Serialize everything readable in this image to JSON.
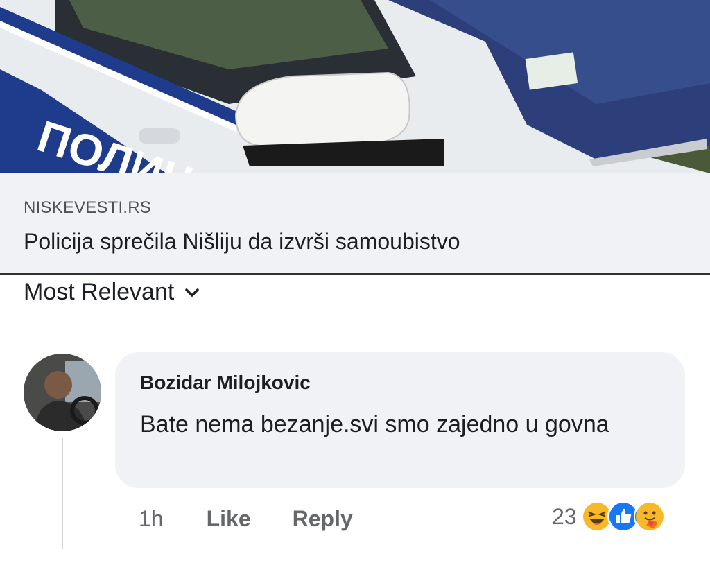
{
  "link_preview": {
    "image_alt": "police car",
    "domain": "NISKEVESTI.RS",
    "title": "Policija sprečila Nišliju da izvrši samoubistvo"
  },
  "sort": {
    "label": "Most Relevant",
    "icon": "chevron-down-icon"
  },
  "comment": {
    "author": "Bozidar Milojkovic",
    "text": "Bate nema bezanje.svi smo zajedno u govna",
    "time": "1h",
    "like_label": "Like",
    "reply_label": "Reply",
    "reaction_count": "23",
    "reactions": [
      "haha-reaction-icon",
      "like-reaction-icon",
      "care-reaction-icon"
    ]
  },
  "colors": {
    "caption_bg": "#f0f2f5",
    "text_primary": "#1c1e21",
    "text_secondary": "#65676b",
    "like_blue": "#1877f2",
    "reaction_yellow": "#f7b928"
  }
}
